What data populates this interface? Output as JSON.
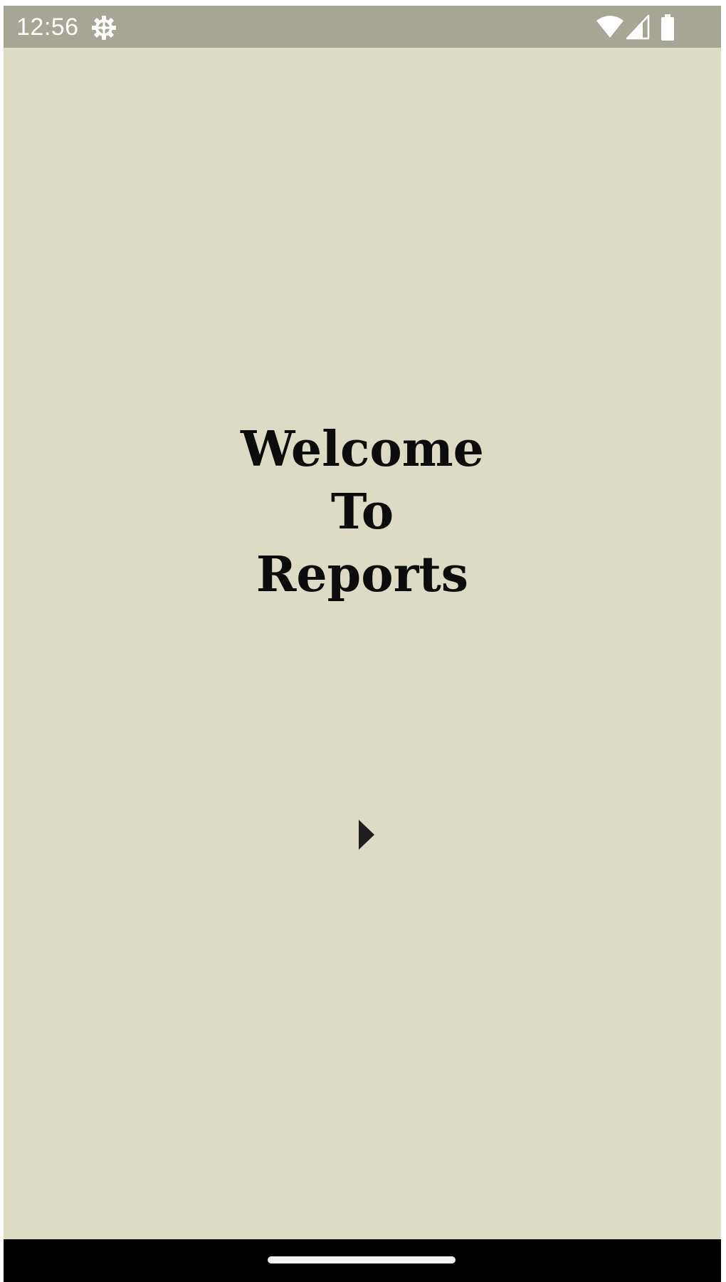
{
  "status_bar": {
    "time": "12:56",
    "background_color": "#a6a596",
    "icons": [
      "settings-icon",
      "wifi-icon",
      "cell-signal-icon",
      "battery-icon"
    ]
  },
  "main": {
    "background_color": "#dddac6",
    "welcome_lines": [
      "Welcome",
      "To",
      "Reports"
    ],
    "play_icon": "play-arrow-icon"
  },
  "nav_bar": {
    "background_color": "#000000",
    "home_handle": "home-handle"
  }
}
